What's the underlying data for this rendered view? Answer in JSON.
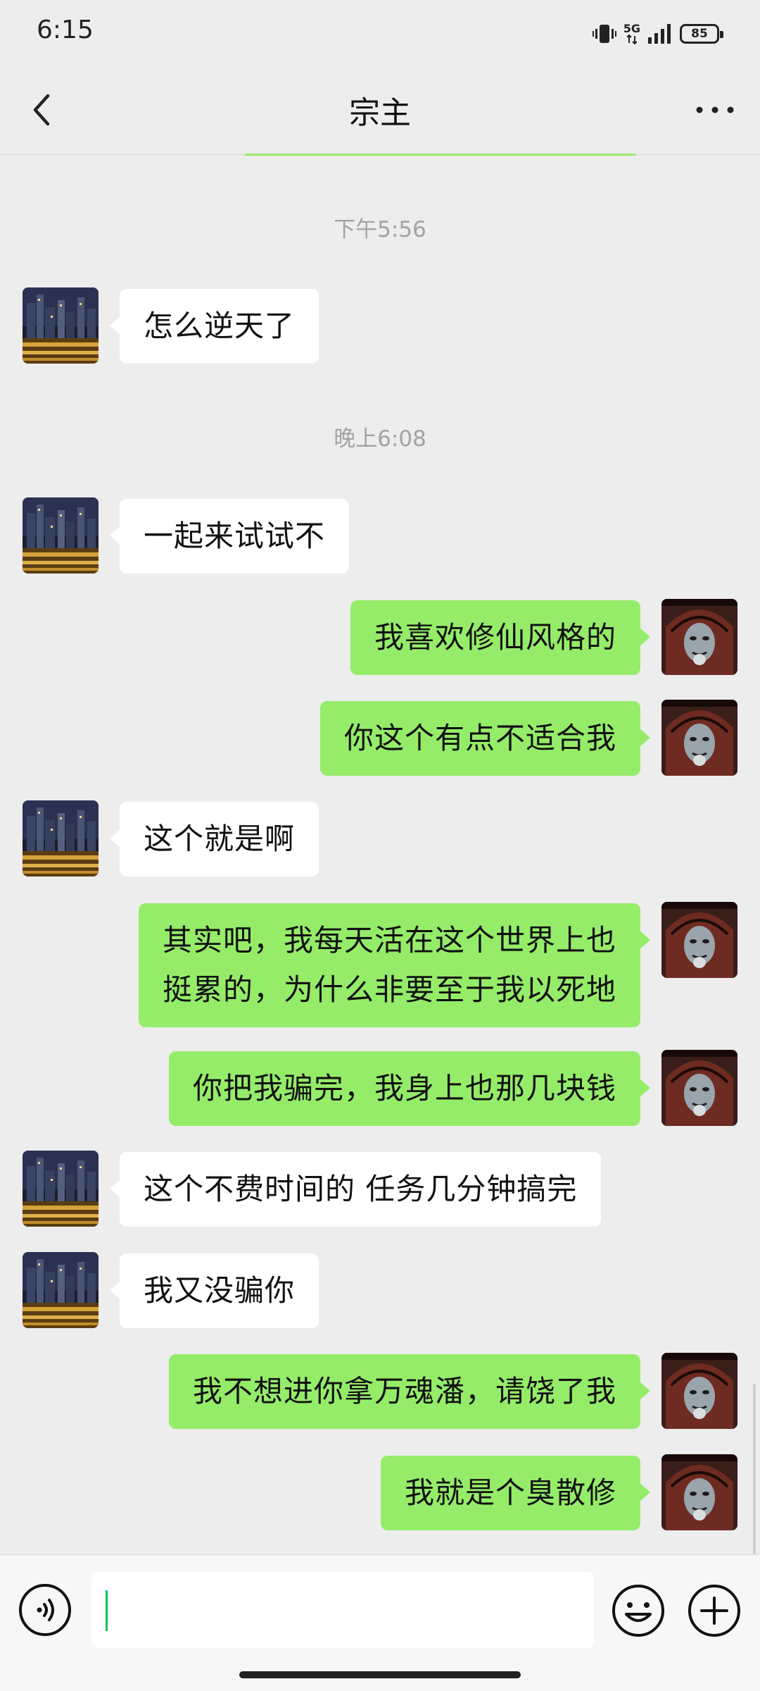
{
  "status_bar": {
    "time": "6:15",
    "network": "5G",
    "battery": "85"
  },
  "header": {
    "title": "宗主"
  },
  "colors": {
    "background": "#ededed",
    "bubble_self": "#95ec69",
    "bubble_other": "#ffffff",
    "accent": "#07c160",
    "timestamp": "#a3a3a3"
  },
  "messages": [
    {
      "type": "time",
      "text": "下午5:56"
    },
    {
      "type": "msg",
      "side": "left",
      "avatar": "city-night-avatar",
      "text": "怎么逆天了"
    },
    {
      "type": "time",
      "text": "晚上6:08"
    },
    {
      "type": "msg",
      "side": "left",
      "avatar": "city-night-avatar",
      "text": "一起来试试不"
    },
    {
      "type": "msg",
      "side": "right",
      "avatar": "hooded-face-avatar",
      "text": "我喜欢修仙风格的"
    },
    {
      "type": "msg",
      "side": "right",
      "avatar": "hooded-face-avatar",
      "text": "你这个有点不适合我"
    },
    {
      "type": "msg",
      "side": "left",
      "avatar": "city-night-avatar",
      "text": "这个就是啊"
    },
    {
      "type": "msg",
      "side": "right",
      "avatar": "hooded-face-avatar",
      "text": "其实吧，我每天活在这个世界上也\n挺累的，为什么非要至于我以死地"
    },
    {
      "type": "msg",
      "side": "right",
      "avatar": "hooded-face-avatar",
      "text": "你把我骗完，我身上也那几块钱"
    },
    {
      "type": "msg",
      "side": "left",
      "avatar": "city-night-avatar",
      "text": "这个不费时间的 任务几分钟搞完"
    },
    {
      "type": "msg",
      "side": "left",
      "avatar": "city-night-avatar",
      "text": "我又没骗你"
    },
    {
      "type": "msg",
      "side": "right",
      "avatar": "hooded-face-avatar",
      "text": "我不想进你拿万魂潘，请饶了我"
    },
    {
      "type": "msg",
      "side": "right",
      "avatar": "hooded-face-avatar",
      "text": "我就是个臭散修"
    }
  ],
  "input": {
    "value": "",
    "placeholder": ""
  }
}
